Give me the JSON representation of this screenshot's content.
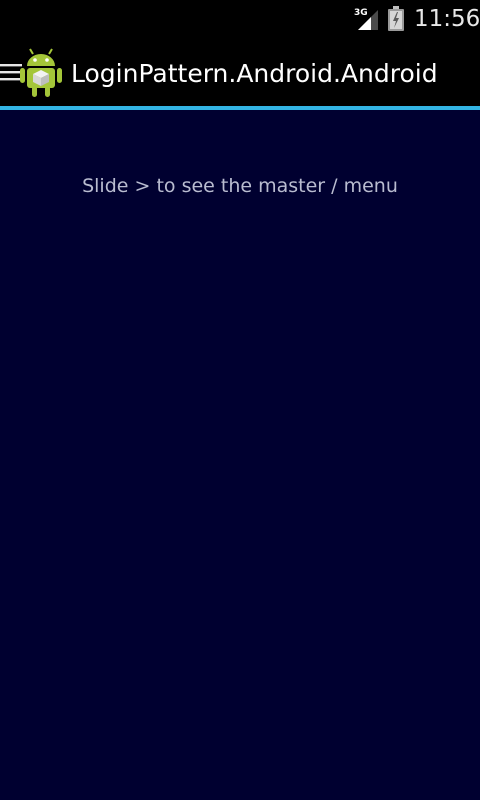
{
  "status_bar": {
    "network_type": "3G",
    "time": "11:56",
    "signal_icon": "signal-icon",
    "battery_icon": "battery-icon"
  },
  "action_bar": {
    "title": "LoginPattern.Android.Android",
    "menu_icon": "hamburger-icon",
    "app_icon": "android-icon"
  },
  "content": {
    "hint": "Slide > to see the master / menu"
  },
  "colors": {
    "background": "#000030",
    "action_bar": "#000000",
    "accent": "#33b5e5",
    "hint_text": "#b9bcd0"
  }
}
